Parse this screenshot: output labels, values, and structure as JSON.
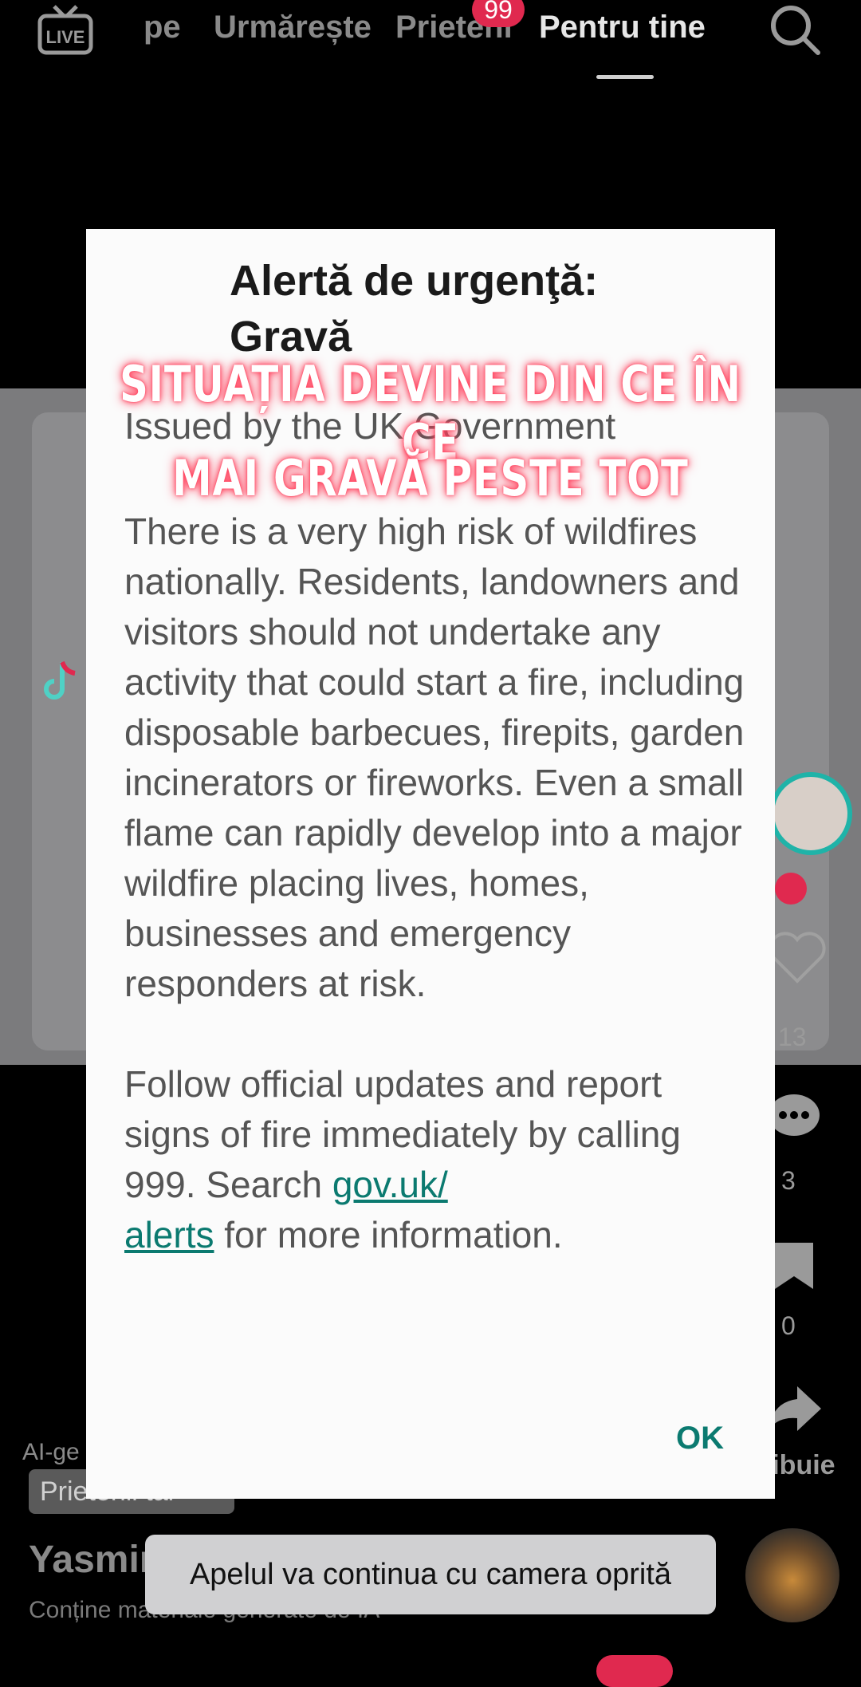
{
  "topnav": {
    "live_label": "LIVE",
    "tabs": [
      "pe",
      "Urmărește",
      "Prieteni",
      "Pentru tine"
    ],
    "friends_badge": "99"
  },
  "side": {
    "comments_count": "3",
    "saves_count": "0",
    "likes_count": "13",
    "share_label": "ribuie"
  },
  "bottom": {
    "ai_label": "AI-ge",
    "friend_chip": "Prietenii tăi",
    "username": "Yasmina C",
    "ai_note": "Conține materiale generate de IA"
  },
  "modal": {
    "title": "Alertă de urgenţă: Gravă",
    "issuer": "Issued by the UK Government",
    "paragraph1": "There is a very high risk of wildfires nationally. Residents, landowners and visitors should not undertake any activity that could start a fire, including disposable barbecues, firepits, garden incinerators or fireworks. Even a small flame can rapidly develop into a major wildfire placing lives, homes, businesses and emergency responders at risk.",
    "paragraph2_pre": "Follow official updates and report signs of fire immediately by calling 999. Search ",
    "paragraph2_link": "gov.uk/\nalerts",
    "paragraph2_post": " for more information.",
    "ok_label": "OK"
  },
  "overlay": {
    "line1": "SITUAȚIA DEVINE DIN CE ÎN CE",
    "line2": "MAI GRAVĂ PESTE TOT"
  },
  "toast": {
    "text": "Apelul va continua cu camera oprită"
  },
  "colors": {
    "accent_red": "#e0294f",
    "link_teal": "#0b7a70"
  }
}
